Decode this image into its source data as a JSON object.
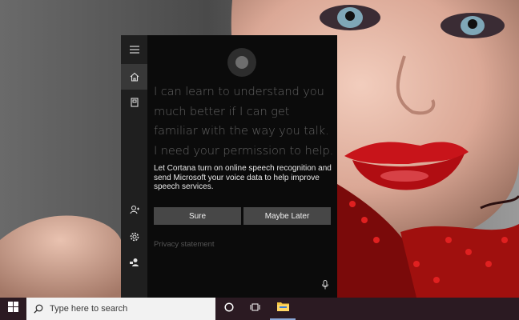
{
  "taskbar": {
    "search_placeholder": "Type here to search"
  },
  "sidebar": {
    "items": [
      {
        "icon": "hamburger-menu-icon"
      },
      {
        "icon": "home-icon",
        "selected": true
      },
      {
        "icon": "notebook-icon"
      },
      {
        "icon": "add-account-icon"
      },
      {
        "icon": "gear-icon"
      },
      {
        "icon": "feedback-icon"
      }
    ]
  },
  "cortana": {
    "heading": "I can learn to understand you much better if I can get familiar with the way you talk. I need your permission to help.",
    "body": "Let Cortana turn on online speech recognition and send Microsoft your voice data to help improve speech services.",
    "sure_label": "Sure",
    "later_label": "Maybe Later",
    "privacy_label": "Privacy statement"
  },
  "colors": {
    "panel_bg": "#0b0b0b",
    "rail_bg": "#1f1f1f",
    "button_bg": "#474747",
    "taskbar_bg": "#2b1a22",
    "start_accent": "#ffffff"
  }
}
